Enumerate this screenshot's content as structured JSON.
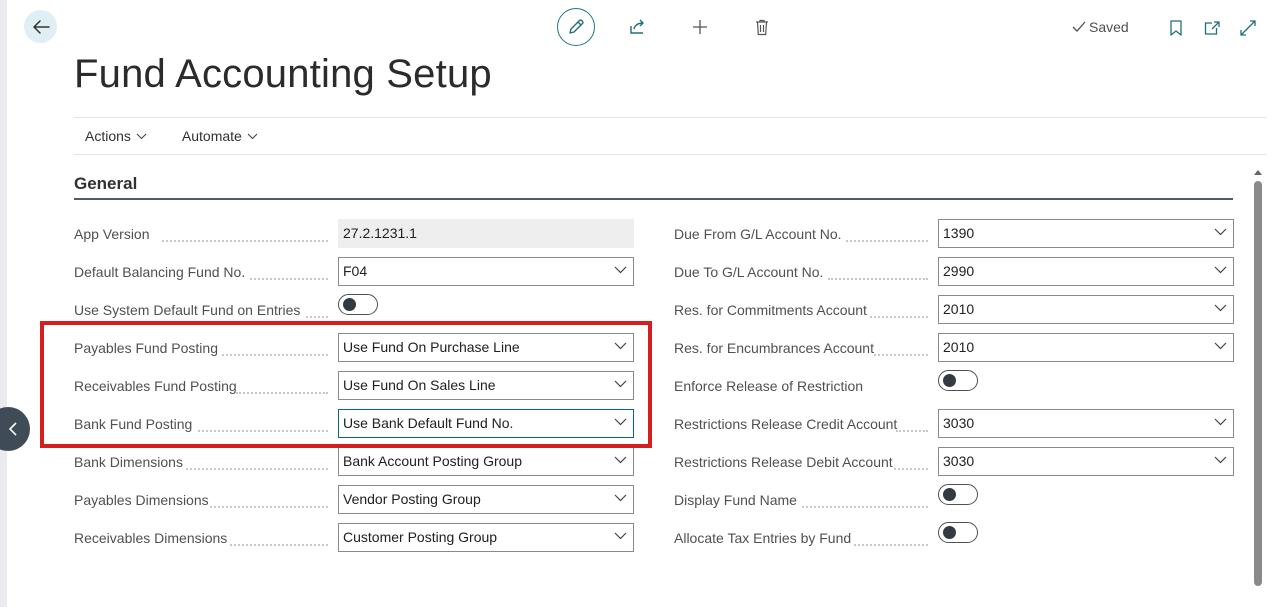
{
  "page": {
    "title": "Fund Accounting Setup",
    "status": "Saved"
  },
  "toolbar": {
    "back_icon": "arrow-left-icon",
    "edit_icon": "pencil-icon",
    "share_icon": "share-icon",
    "new_icon": "plus-icon",
    "delete_icon": "trash-icon",
    "bookmark_icon": "bookmark-icon",
    "open_new_window_icon": "open-in-new-window-icon",
    "expand_icon": "expand-icon"
  },
  "actions": [
    {
      "label": "Actions"
    },
    {
      "label": "Automate"
    }
  ],
  "section": {
    "title": "General"
  },
  "left_fields": [
    {
      "label": "App Version",
      "type": "readonly",
      "value": "27.2.1231.1"
    },
    {
      "label": "Default Balancing Fund No.",
      "type": "select",
      "value": "F04"
    },
    {
      "label": "Use System Default Fund on Entries",
      "type": "toggle",
      "value": false
    },
    {
      "label": "Payables Fund Posting",
      "type": "select",
      "value": "Use Fund On Purchase Line"
    },
    {
      "label": "Receivables Fund Posting",
      "type": "select",
      "value": "Use Fund On Sales Line"
    },
    {
      "label": "Bank Fund Posting",
      "type": "select",
      "value": "Use Bank Default Fund No."
    },
    {
      "label": "Bank Dimensions",
      "type": "select",
      "value": "Bank Account Posting Group"
    },
    {
      "label": "Payables Dimensions",
      "type": "select",
      "value": "Vendor Posting Group"
    },
    {
      "label": "Receivables Dimensions",
      "type": "select",
      "value": "Customer Posting Group"
    }
  ],
  "right_fields": [
    {
      "label": "Due From G/L Account No.",
      "type": "select",
      "value": "1390"
    },
    {
      "label": "Due To G/L Account No.",
      "type": "select",
      "value": "2990"
    },
    {
      "label": "Res. for Commitments Account",
      "type": "select",
      "value": "2010"
    },
    {
      "label": "Res. for Encumbrances Account",
      "type": "select",
      "value": "2010"
    },
    {
      "label": "Enforce Release of Restriction",
      "type": "toggle",
      "value": false
    },
    {
      "label": "Restrictions Release Credit Account",
      "type": "select",
      "value": "3030"
    },
    {
      "label": "Restrictions Release Debit Account",
      "type": "select",
      "value": "3030"
    },
    {
      "label": "Display Fund Name",
      "type": "toggle",
      "value": false
    },
    {
      "label": "Allocate Tax Entries by Fund",
      "type": "toggle",
      "value": false
    }
  ],
  "colors": {
    "highlight": "#d41f1f",
    "accent": "#0b6a78",
    "back_button_bg": "#dfeff4"
  }
}
